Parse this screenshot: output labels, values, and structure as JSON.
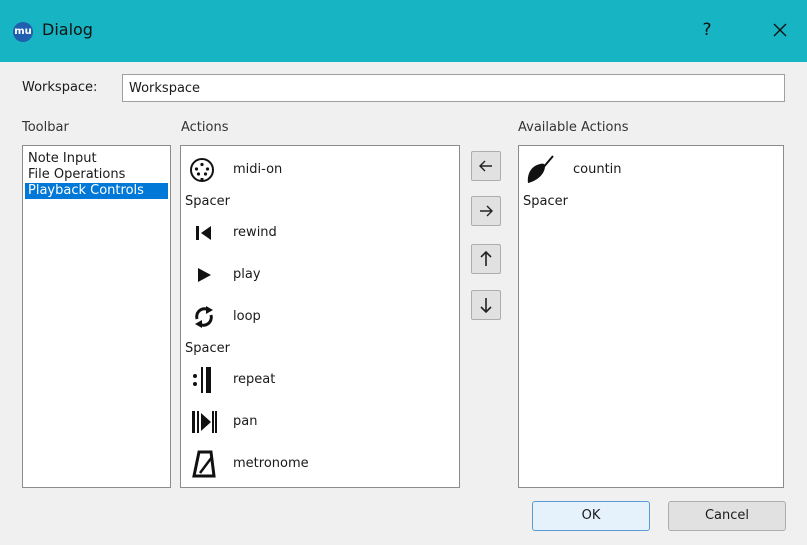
{
  "window": {
    "title": "Dialog",
    "app_icon": "mu",
    "help": "?",
    "close": "close-icon"
  },
  "workspace": {
    "label": "Workspace:",
    "value": "Workspace"
  },
  "columns": {
    "toolbar": "Toolbar",
    "actions": "Actions",
    "available": "Available Actions"
  },
  "toolbar_items": [
    {
      "label": "Note Input"
    },
    {
      "label": "File Operations"
    },
    {
      "label": "Playback Controls",
      "selected": true
    }
  ],
  "actions": [
    {
      "label": "midi-on",
      "icon": "midi-icon"
    },
    {
      "label": "Spacer"
    },
    {
      "label": "rewind",
      "icon": "rewind-icon"
    },
    {
      "label": "play",
      "icon": "play-icon"
    },
    {
      "label": "loop",
      "icon": "loop-icon"
    },
    {
      "label": "Spacer"
    },
    {
      "label": "repeat",
      "icon": "repeat-icon"
    },
    {
      "label": "pan",
      "icon": "pan-icon"
    },
    {
      "label": "metronome",
      "icon": "metronome-icon"
    }
  ],
  "available": [
    {
      "label": "countin",
      "icon": "countin-icon"
    },
    {
      "label": "Spacer"
    }
  ],
  "buttons": {
    "ok": "OK",
    "cancel": "Cancel"
  }
}
